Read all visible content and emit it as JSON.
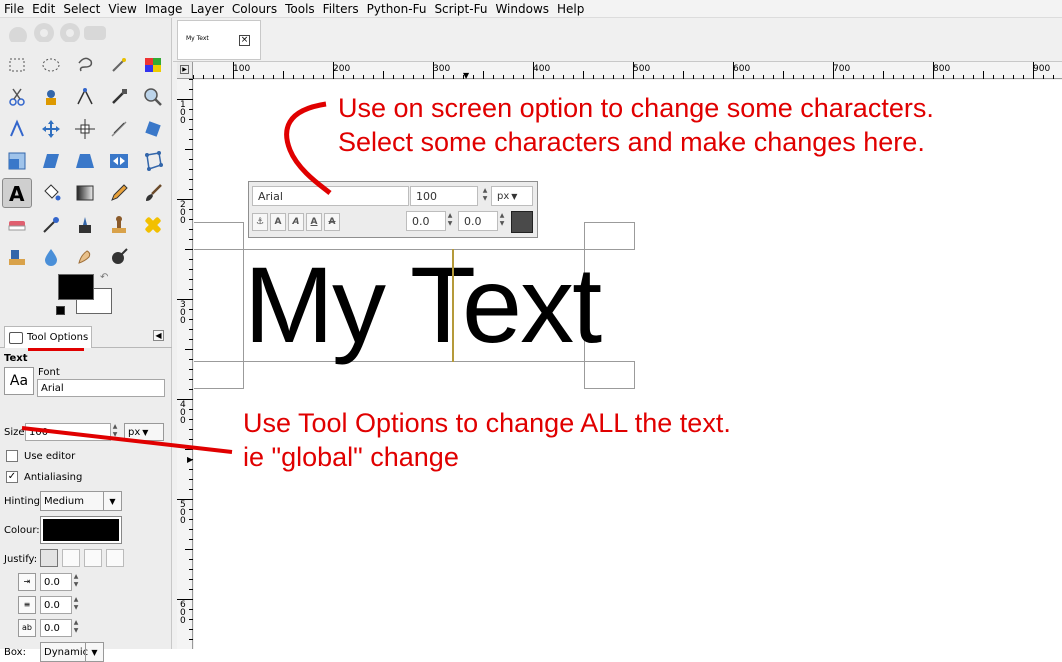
{
  "menu": [
    "File",
    "Edit",
    "Select",
    "View",
    "Image",
    "Layer",
    "Colours",
    "Tools",
    "Filters",
    "Python-Fu",
    "Script-Fu",
    "Windows",
    "Help"
  ],
  "image_tab": {
    "thumb_text": "My Text"
  },
  "ruler": {
    "h_labels": [
      "100",
      "200",
      "300",
      "400",
      "500",
      "600",
      "700",
      "800",
      "900"
    ],
    "v_labels": [
      "100",
      "200",
      "300",
      "400",
      "500",
      "600"
    ]
  },
  "tool_options": {
    "tab_label": "Tool Options",
    "section": "Text",
    "font_label": "Font",
    "font_preview": "Aa",
    "font_value": "Arial",
    "size_label": "Size:",
    "size_value": "100",
    "size_unit": "px",
    "use_editor": "Use editor",
    "use_editor_checked": false,
    "antialiasing": "Antialiasing",
    "antialiasing_checked": true,
    "hinting_label": "Hinting:",
    "hinting_value": "Medium",
    "colour_label": "Colour:",
    "colour_value": "#000000",
    "justify_label": "Justify:",
    "indent_value": "0.0",
    "line_spacing_value": "0.0",
    "letter_spacing_value": "0.0",
    "box_label": "Box:",
    "box_value": "Dynamic"
  },
  "canvas_text": "My Text",
  "style_editor": {
    "font": "Arial",
    "size": "100",
    "unit": "px",
    "baseline": "0.0",
    "kerning": "0.0",
    "colour": "#4a4a4a"
  },
  "annotations": {
    "top_line1": "Use on screen option to change some characters.",
    "top_line2": "Select some characters and make changes here.",
    "bottom_line1": "Use Tool Options to change ALL the text.",
    "bottom_line2": "ie \"global\" change",
    "color": "#e00000"
  }
}
